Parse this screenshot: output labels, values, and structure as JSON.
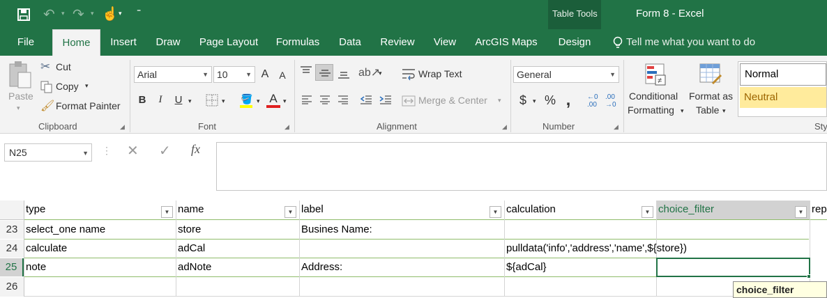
{
  "title_bar": {
    "context_tab_group": "Table Tools",
    "window_title": "Form 8 - Excel"
  },
  "tabs": [
    "File",
    "Home",
    "Insert",
    "Draw",
    "Page Layout",
    "Formulas",
    "Data",
    "Review",
    "View",
    "ArcGIS Maps",
    "Design"
  ],
  "tell_me": "Tell me what you want to do",
  "ribbon": {
    "clipboard": {
      "paste": "Paste",
      "cut": "Cut",
      "copy": "Copy",
      "format_painter": "Format Painter",
      "group_label": "Clipboard"
    },
    "font": {
      "font_name": "Arial",
      "font_size": "10",
      "bold": "B",
      "italic": "I",
      "underline": "U",
      "font_color_letter": "A",
      "grow_letter": "A",
      "shrink_letter": "A",
      "group_label": "Font"
    },
    "alignment": {
      "wrap_text": "Wrap Text",
      "merge_center": "Merge & Center",
      "group_label": "Alignment"
    },
    "number": {
      "format": "General",
      "currency": "$",
      "percent": "%",
      "comma": ",",
      "group_label": "Number"
    },
    "styles": {
      "conditional_formatting_1": "Conditional",
      "conditional_formatting_2": "Formatting",
      "format_as_table_1": "Format as",
      "format_as_table_2": "Table",
      "style_normal": "Normal",
      "style_neutral": "Neutral",
      "group_label_partial": "Sty"
    }
  },
  "formula_bar": {
    "name_box": "N25",
    "fx": "fx",
    "formula": ""
  },
  "columns": [
    {
      "header": "type"
    },
    {
      "header": "name"
    },
    {
      "header": "label"
    },
    {
      "header": "calculation"
    },
    {
      "header": "choice_filter"
    },
    {
      "header": "rep"
    }
  ],
  "rows": [
    {
      "num": "23",
      "cells": [
        "select_one name",
        "store",
        "Busines Name:",
        "",
        ""
      ]
    },
    {
      "num": "24",
      "cells": [
        "calculate",
        "adCal",
        "",
        "pulldata('info','address','name',${store})",
        ""
      ]
    },
    {
      "num": "25",
      "cells": [
        "note",
        "adNote",
        "Address:",
        "${adCal}",
        ""
      ]
    },
    {
      "num": "26",
      "cells": [
        "",
        "",
        "",
        "",
        ""
      ]
    }
  ],
  "tooltip": "choice_filter",
  "colors": {
    "excel_green": "#217346",
    "table_border": "#8fbc6a",
    "neutral_style": "#ffeb9c"
  }
}
